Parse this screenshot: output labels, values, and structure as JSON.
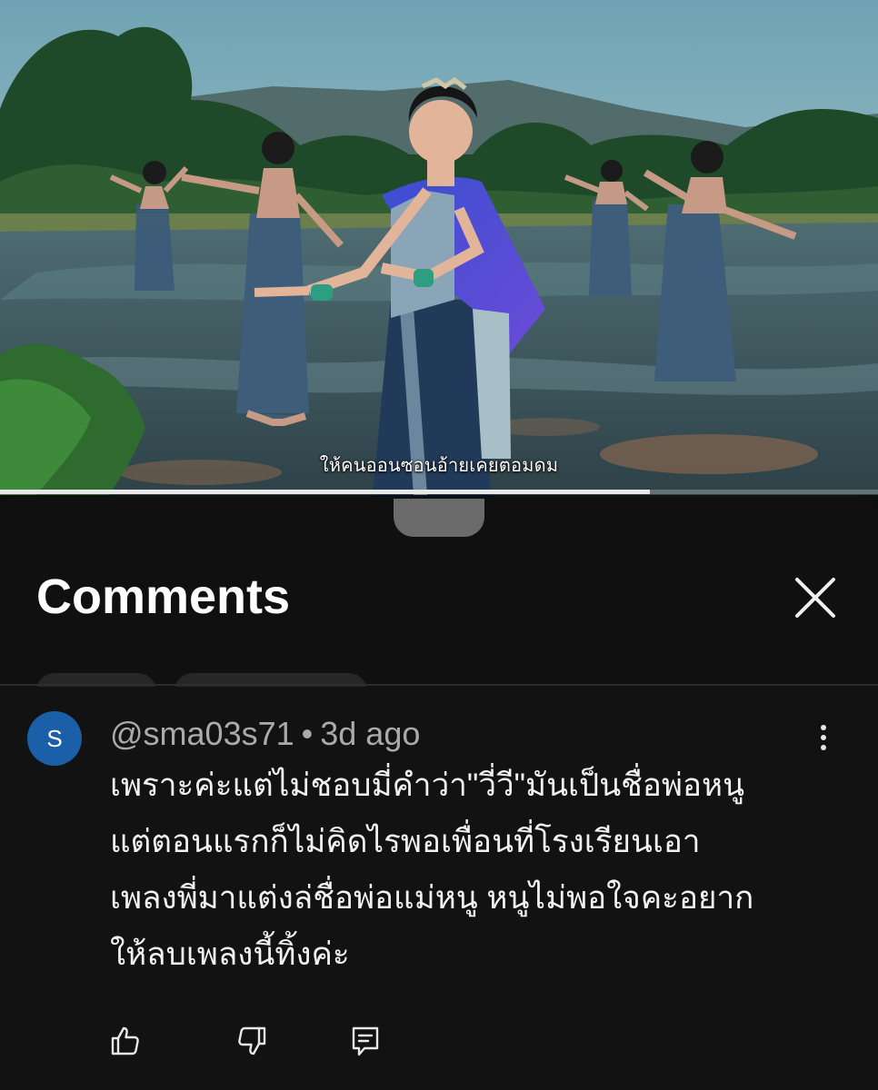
{
  "video": {
    "subtitle": "ให้คนออนซอนอ้ายเคยตอมดม",
    "progress": 0.74
  },
  "comments_panel": {
    "title": "Comments",
    "close_icon": "close-icon"
  },
  "comment": {
    "avatar_letter": "S",
    "avatar_color": "#1a5fa8",
    "author": "@sma03s71",
    "separator": "•",
    "time": "3d ago",
    "text_lines": [
      "เพราะค่ะแต่ไม่ชอบมี่คำว่า\"วี่วี\"มันเป็นชื่อพ่อหนู",
      "แต่ตอนแรกก็ไม่คิดไรพอเพื่อนที่โรงเรียนเอา",
      "เพลงพี่มาแต่งล่ชื่อพ่อแม่หนู หนูไม่พอใจคะอยาก",
      "ให้ลบเพลงนี้ทิ้งค่ะ"
    ],
    "actions": [
      "thumbs-up-icon",
      "thumbs-down-icon",
      "reply-icon"
    ],
    "menu_icon": "more-vertical-icon"
  }
}
